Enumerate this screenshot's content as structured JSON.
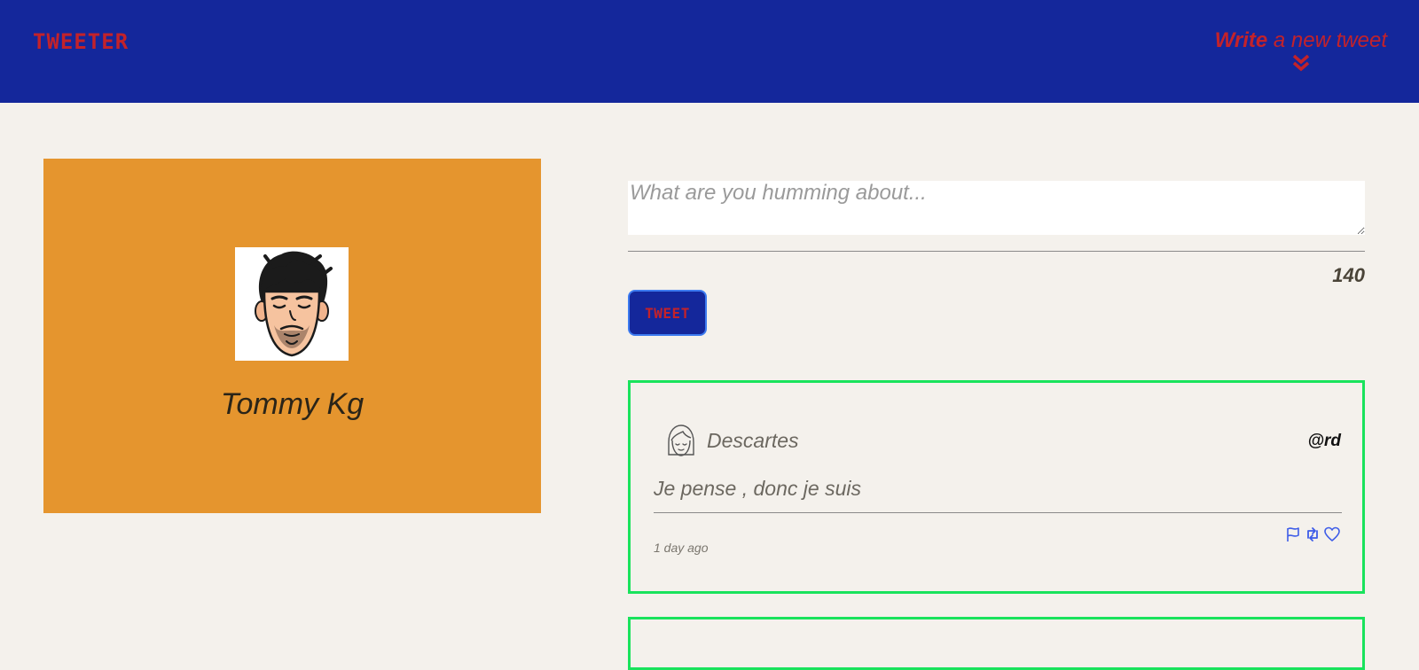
{
  "app": {
    "logo": "TWEETER"
  },
  "header": {
    "compose_toggle_strong": "Write",
    "compose_toggle_light": " a new tweet"
  },
  "profile": {
    "name": "Tommy Kg"
  },
  "composer": {
    "placeholder": "What are you humming about...",
    "value": "",
    "char_counter": "140",
    "submit_label": "TWEET"
  },
  "tweets": [
    {
      "author": "Descartes",
      "handle": "@rd",
      "text": "Je pense , donc je suis",
      "time": "1 day ago"
    }
  ],
  "colors": {
    "header_bg": "#14279b",
    "accent_red": "#c3222a",
    "profile_bg": "#e5952e",
    "tweet_border": "#19e35c",
    "action_icon": "#3d5ce8",
    "page_bg": "#f4f1ec"
  },
  "icons": {
    "compose_toggle": "double-chevron-down-icon",
    "actions": [
      "flag-icon",
      "retweet-icon",
      "heart-icon"
    ]
  }
}
